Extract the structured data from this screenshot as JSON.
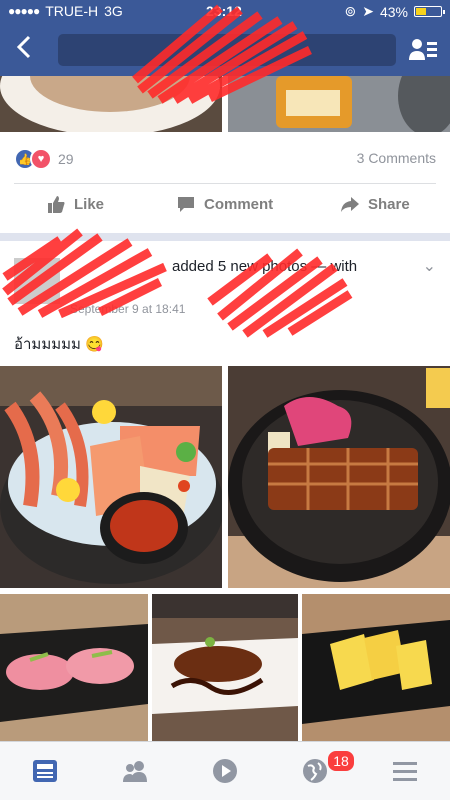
{
  "status_bar": {
    "carrier": "TRUE-H",
    "network": "3G",
    "time": "23:12",
    "battery": "43%",
    "battery_level": 0.43
  },
  "post1": {
    "reaction_count": "29",
    "comments": "3 Comments",
    "actions": {
      "like": "Like",
      "comment": "Comment",
      "share": "Share"
    }
  },
  "post2": {
    "header_text": "added 5 new photos — with",
    "time": "September 9 at 18:41",
    "caption": "อ้ามมมมม 😋"
  },
  "tabbar": {
    "notifications_badge": "18"
  },
  "colors": {
    "brand": "#3b5998",
    "like_blue": "#4267b2",
    "love_red": "#f25268",
    "badge_red": "#fa3e3e"
  }
}
